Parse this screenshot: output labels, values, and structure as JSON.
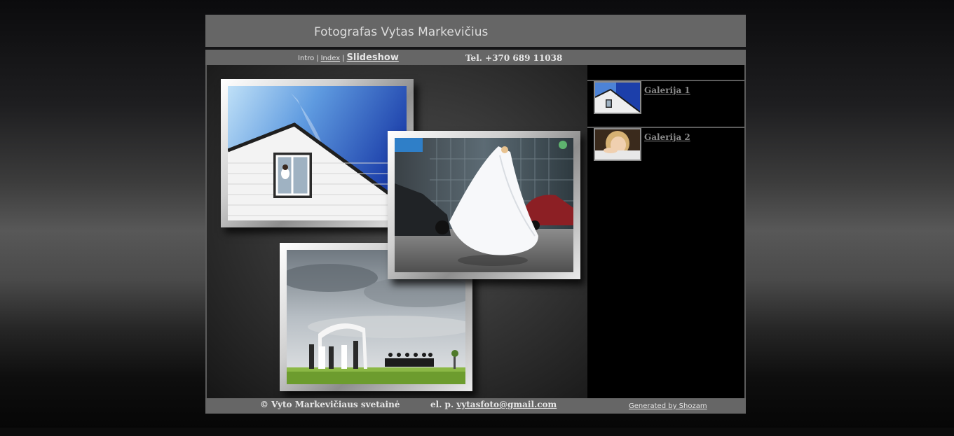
{
  "header": {
    "title": "Fotografas Vytas Markevičius"
  },
  "nav": {
    "intro": "Intro",
    "separator1": "|",
    "index": "Index",
    "separator2": "|",
    "slideshow": "Slideshow",
    "phone": "Tel. +370 689 11038"
  },
  "galleries": [
    {
      "label": "Galerija 1",
      "thumb_icon": "house-photo-thumbnail"
    },
    {
      "label": "Galerija 2",
      "thumb_icon": "portrait-photo-thumbnail"
    }
  ],
  "photos": [
    {
      "icon": "house-window-bride-photo"
    },
    {
      "icon": "bride-in-city-photo"
    },
    {
      "icon": "wedding-ceremony-photo"
    }
  ],
  "footer": {
    "copyright": "© Vyto Markevičiaus svetainė",
    "email_prefix": "el. p.",
    "email": "vytasfoto@gmail.com",
    "generated": "Generated by Shozam"
  },
  "colors": {
    "bar_gray": "#666666",
    "panel_black": "#000000",
    "link_gray": "#8a8a8a"
  }
}
